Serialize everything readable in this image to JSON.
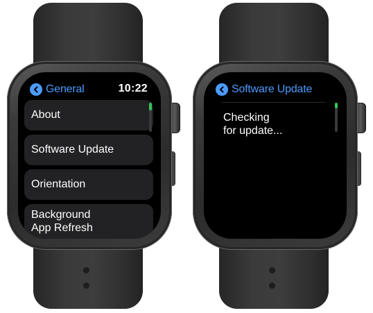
{
  "left_screen": {
    "back_label": "General",
    "time": "10:22",
    "items": [
      {
        "label": "About"
      },
      {
        "label": "Software Update"
      },
      {
        "label": "Orientation"
      },
      {
        "label": "Background\nApp Refresh"
      }
    ],
    "scroll_fraction": 0.25
  },
  "right_screen": {
    "back_label": "Software Update",
    "status_text": "Checking\nfor update...",
    "scroll_fraction": 0.2
  },
  "colors": {
    "accent": "#4c9bff",
    "scroll_thumb": "#34c759",
    "cell_background": "#222224"
  },
  "icons": {
    "back": "chevron-left-icon"
  }
}
